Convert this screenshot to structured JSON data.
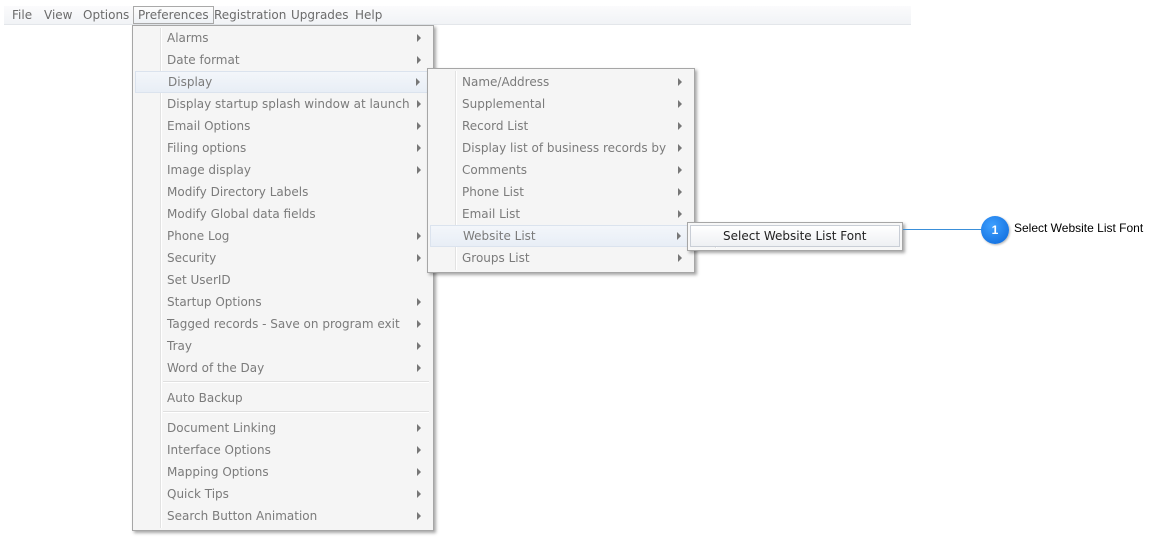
{
  "menubar": {
    "items": [
      "File",
      "View",
      "Options",
      "Preferences",
      "Registration",
      "Upgrades",
      "Help"
    ],
    "active": "Preferences"
  },
  "preferences_menu": {
    "group1": [
      {
        "label": "Alarms",
        "submenu": true
      },
      {
        "label": "Date format",
        "submenu": true
      },
      {
        "label": "Display",
        "submenu": true,
        "highlighted": true
      },
      {
        "label": "Display startup splash window at launch",
        "submenu": true
      },
      {
        "label": "Email Options",
        "submenu": true
      },
      {
        "label": "Filing options",
        "submenu": true
      },
      {
        "label": "Image display",
        "submenu": true
      },
      {
        "label": "Modify Directory Labels",
        "submenu": false
      },
      {
        "label": "Modify Global data fields",
        "submenu": false
      },
      {
        "label": "Phone Log",
        "submenu": true
      },
      {
        "label": "Security",
        "submenu": true
      },
      {
        "label": "Set UserID",
        "submenu": false
      },
      {
        "label": "Startup Options",
        "submenu": true
      },
      {
        "label": "Tagged records - Save on program exit",
        "submenu": true
      },
      {
        "label": "Tray",
        "submenu": true
      },
      {
        "label": "Word of the Day",
        "submenu": true
      }
    ],
    "group2": [
      {
        "label": "Auto Backup",
        "submenu": false
      }
    ],
    "group3": [
      {
        "label": "Document Linking",
        "submenu": true
      },
      {
        "label": "Interface Options",
        "submenu": true
      },
      {
        "label": "Mapping Options",
        "submenu": true
      },
      {
        "label": "Quick Tips",
        "submenu": true
      },
      {
        "label": "Search Button Animation",
        "submenu": true
      }
    ]
  },
  "display_menu": {
    "items": [
      {
        "label": "Name/Address",
        "submenu": true
      },
      {
        "label": "Supplemental",
        "submenu": true
      },
      {
        "label": "Record List",
        "submenu": true
      },
      {
        "label": "Display list of business records by",
        "submenu": true
      },
      {
        "label": "Comments",
        "submenu": true
      },
      {
        "label": "Phone List",
        "submenu": true
      },
      {
        "label": "Email List",
        "submenu": true
      },
      {
        "label": "Website List",
        "submenu": true,
        "highlighted": true
      },
      {
        "label": "Groups List",
        "submenu": true
      }
    ]
  },
  "website_list_menu": {
    "items": [
      {
        "label": "Select Website List Font",
        "highlighted": true
      }
    ]
  },
  "callout": {
    "number": "1",
    "text": "Select Website List Font",
    "color": "#0a66d8"
  }
}
